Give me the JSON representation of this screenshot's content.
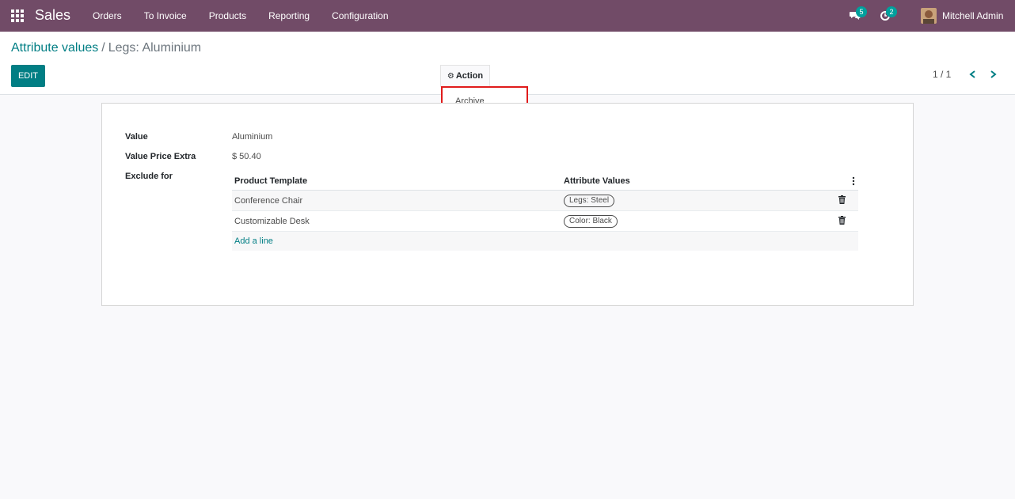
{
  "navbar": {
    "app_name": "Sales",
    "menu": [
      "Orders",
      "To Invoice",
      "Products",
      "Reporting",
      "Configuration"
    ],
    "messages_badge": "5",
    "activities_badge": "2",
    "user_name": "Mitchell Admin",
    "bg_color": "#714b67"
  },
  "breadcrumb": {
    "parent": "Attribute values",
    "separator": "/",
    "current": "Legs: Aluminium"
  },
  "buttons": {
    "edit": "EDIT",
    "action": "Action"
  },
  "pager": {
    "value": "1 / 1"
  },
  "action_menu": {
    "items": [
      "Archive"
    ]
  },
  "form": {
    "value_label": "Value",
    "value": "Aluminium",
    "price_extra_label": "Value Price Extra",
    "price_extra": "$ 50.40",
    "exclude_for_label": "Exclude for",
    "columns": [
      "Product Template",
      "Attribute Values"
    ],
    "rows": [
      {
        "product_template": "Conference Chair",
        "attribute_value": "Legs: Steel"
      },
      {
        "product_template": "Customizable Desk",
        "attribute_value": "Color: Black"
      }
    ],
    "add_line": "Add a line"
  },
  "accent_color": "#017e84"
}
